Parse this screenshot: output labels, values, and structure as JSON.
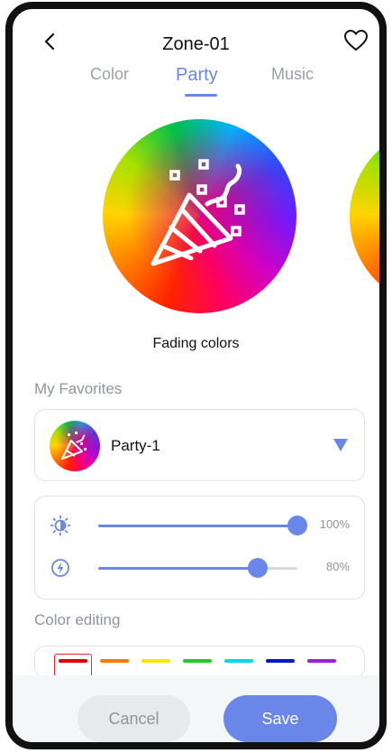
{
  "header": {
    "title": "Zone-01",
    "back_icon": "chevron-left-icon",
    "favorite_icon": "heart-outline-icon"
  },
  "tabs": [
    {
      "label": "Color",
      "active": false
    },
    {
      "label": "Party",
      "active": true
    },
    {
      "label": "Music",
      "active": false
    }
  ],
  "effect": {
    "name": "Fading colors",
    "icon": "party-popper-icon"
  },
  "favorites": {
    "section_label": "My Favorites",
    "selected": "Party-1",
    "thumbnail_icon": "party-popper-icon",
    "dropdown_icon": "triangle-down-icon"
  },
  "sliders": [
    {
      "name": "brightness",
      "icon": "brightness-icon",
      "value": 100,
      "value_label": "100%"
    },
    {
      "name": "speed",
      "icon": "lightning-icon",
      "value": 80,
      "value_label": "80%"
    }
  ],
  "color_editing": {
    "section_label": "Color editing",
    "swatches": [
      "#e00000",
      "#ff7a00",
      "#f6e600",
      "#22cc22",
      "#00d8e8",
      "#0018c8",
      "#9b20d8"
    ],
    "selected_index": 0
  },
  "actions": {
    "cancel_label": "Cancel",
    "save_label": "Save"
  },
  "colors": {
    "accent": "#6a86e8",
    "muted": "#8f959b"
  }
}
